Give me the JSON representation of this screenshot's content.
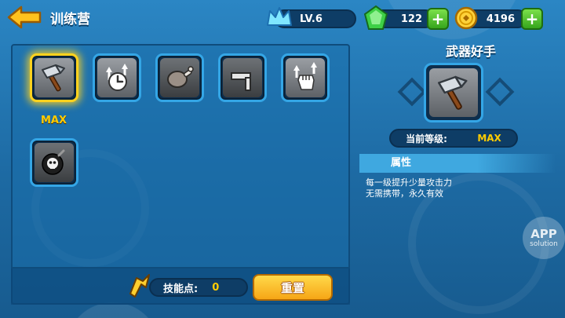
{
  "header": {
    "title": "训练营",
    "level": "LV.6",
    "gems": "122",
    "coins": "4196"
  },
  "skills": {
    "items": [
      {
        "icon": "hammer-icon",
        "selected": true,
        "status": "MAX"
      },
      {
        "icon": "clock-boost-icon",
        "selected": false
      },
      {
        "icon": "meat-icon",
        "selected": false
      },
      {
        "icon": "anvil-hammer-icon",
        "selected": false
      },
      {
        "icon": "fist-boost-icon",
        "selected": false
      },
      {
        "icon": "skull-bomb-icon",
        "selected": false
      }
    ],
    "max_label": "MAX"
  },
  "bottom": {
    "points_label": "技能点:",
    "points_value": "0",
    "reset_label": "重置"
  },
  "detail": {
    "name": "武器好手",
    "level_label": "当前等级:",
    "level_value": "MAX",
    "attr_tab": "属性",
    "desc_line1": "每一级提升少量攻击力",
    "desc_line2": "无需携带，永久有效"
  },
  "watermark": {
    "line1": "APP",
    "line2": "solution"
  },
  "colors": {
    "accent_gold": "#ffcc00",
    "slot_border": "#34a6e6",
    "selected_border": "#ffd21e",
    "plus_green": "#36a51c"
  }
}
